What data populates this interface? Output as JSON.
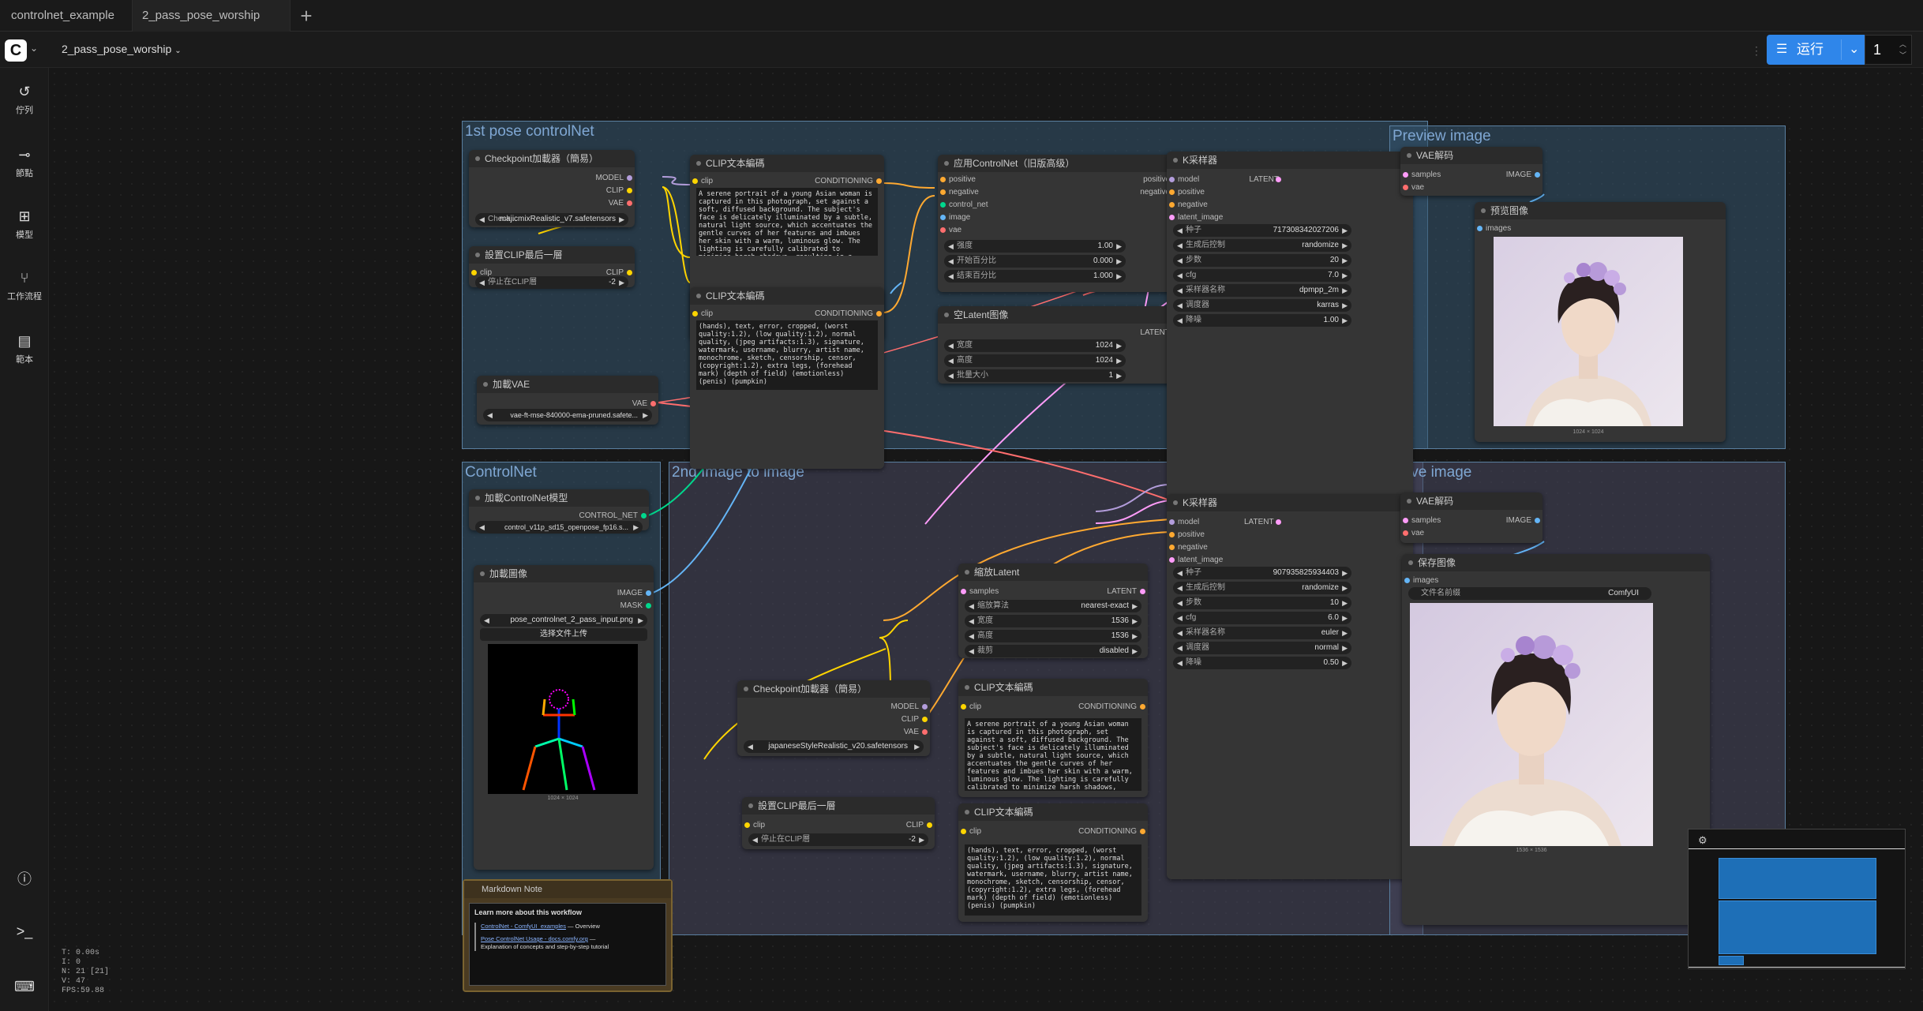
{
  "tabs": [
    {
      "label": "controlnet_example"
    },
    {
      "label": "2_pass_pose_worship"
    }
  ],
  "workflow_name": "2_pass_pose_worship",
  "run": {
    "label": "运行",
    "count": "1"
  },
  "sidebar": [
    {
      "label": "佇列",
      "icon": "history-icon"
    },
    {
      "label": "節點",
      "icon": "node-icon"
    },
    {
      "label": "模型",
      "icon": "model-icon"
    },
    {
      "label": "工作流程",
      "icon": "workflow-icon"
    },
    {
      "label": "範本",
      "icon": "template-icon"
    }
  ],
  "groups": {
    "g1": "1st pose controlNet",
    "g2": "Preview image",
    "g3": "ControlNet",
    "g4": "2nd Image to image",
    "g5": "Save image"
  },
  "nodes": {
    "ckpt1": {
      "title": "Checkpoint加載器（簡易）",
      "out_model": "MODEL",
      "out_clip": "CLIP",
      "out_vae": "VAE",
      "w_label": "Check...",
      "w_value": "majicmixRealistic_v7.safetensors"
    },
    "clipskip1": {
      "title": "設置CLIP最后一層",
      "in": "clip",
      "out": "CLIP",
      "w_label": "停止在CLIP層",
      "w_value": "-2"
    },
    "vae1": {
      "title": "加載VAE",
      "out": "VAE",
      "w_value": "vae-ft-mse-840000-ema-pruned.safete..."
    },
    "clip_pos1": {
      "title": "CLIP文本編碼",
      "in": "clip",
      "out": "CONDITIONING",
      "text": "A serene portrait of a young Asian woman is captured in this photograph, set against a soft, diffused background. The subject's face is delicately illuminated by a subtle, natural light source, which accentuates the gentle curves of her features and imbues her skin with a warm, luminous glow. The lighting is carefully calibrated to minimize harsh shadows, resulting in a softly nuanced and realistic representation of the subject's complexion."
    },
    "clip_neg1": {
      "title": "CLIP文本編碼",
      "in": "clip",
      "out": "CONDITIONING",
      "text": "(hands), text, error, cropped, (worst quality:1.2), (low quality:1.2), normal quality, (jpeg artifacts:1.3), signature, watermark, username, blurry, artist name, monochrome, sketch, censorship, censor, (copyright:1.2), extra legs, (forehead mark) (depth of field) (emotionless) (penis) (pumpkin)"
    },
    "apply_cn": {
      "title": "应用ControlNet（旧版高级）",
      "in": [
        "positive",
        "negative",
        "control_net",
        "image",
        "vae"
      ],
      "out": [
        "positive",
        "negative"
      ],
      "w": [
        {
          "l": "强度",
          "v": "1.00"
        },
        {
          "l": "开始百分比",
          "v": "0.000"
        },
        {
          "l": "结束百分比",
          "v": "1.000"
        }
      ]
    },
    "empty_latent": {
      "title": "空Latent图像",
      "out": "LATENT",
      "w": [
        {
          "l": "宽度",
          "v": "1024"
        },
        {
          "l": "高度",
          "v": "1024"
        },
        {
          "l": "批量大小",
          "v": "1"
        }
      ]
    },
    "ksampler1": {
      "title": "K采样器",
      "in": [
        "model",
        "positive",
        "negative",
        "latent_image"
      ],
      "out": "LATENT",
      "w": [
        {
          "l": "种子",
          "v": "717308342027206"
        },
        {
          "l": "生成后控制",
          "v": "randomize"
        },
        {
          "l": "步数",
          "v": "20"
        },
        {
          "l": "cfg",
          "v": "7.0"
        },
        {
          "l": "采样器名称",
          "v": "dpmpp_2m"
        },
        {
          "l": "调度器",
          "v": "karras"
        },
        {
          "l": "降噪",
          "v": "1.00"
        }
      ]
    },
    "vaedecode1": {
      "title": "VAE解码",
      "in": [
        "samples",
        "vae"
      ],
      "out": "IMAGE"
    },
    "preview": {
      "title": "预览图像",
      "in": "images",
      "caption": "1024 × 1024"
    },
    "cn_loader": {
      "title": "加載ControlNet模型",
      "out": "CONTROL_NET",
      "w_value": "control_v11p_sd15_openpose_fp16.s..."
    },
    "load_image": {
      "title": "加載圖像",
      "out_image": "IMAGE",
      "out_mask": "MASK",
      "w_value": "pose_controlnet_2_pass_input.png",
      "upload": "选择文件上传",
      "caption": "1024 × 1024"
    },
    "upscale": {
      "title": "縮放Latent",
      "in": "samples",
      "out": "LATENT",
      "w": [
        {
          "l": "缩放算法",
          "v": "nearest-exact"
        },
        {
          "l": "宽度",
          "v": "1536"
        },
        {
          "l": "高度",
          "v": "1536"
        },
        {
          "l": "裁剪",
          "v": "disabled"
        }
      ]
    },
    "ckpt2": {
      "title": "Checkpoint加載器（簡易）",
      "out_model": "MODEL",
      "out_clip": "CLIP",
      "out_vae": "VAE",
      "w_value": "japaneseStyleRealistic_v20.safetensors"
    },
    "clipskip2": {
      "title": "設置CLIP最后一層",
      "in": "clip",
      "out": "CLIP",
      "w_label": "停止在CLIP層",
      "w_value": "-2"
    },
    "clip_pos2": {
      "title": "CLIP文本編碼",
      "in": "clip",
      "out": "CONDITIONING",
      "text": "A serene portrait of a young Asian woman is captured in this photograph, set against a soft, diffused background. The subject's face is delicately illuminated by a subtle, natural light source, which accentuates the gentle curves of her features and imbues her skin with a warm, luminous glow. The lighting is carefully calibrated to minimize harsh shadows, resulting in a softly nuanced and realistic representation of the subject's"
    },
    "clip_neg2": {
      "title": "CLIP文本編碼",
      "in": "clip",
      "out": "CONDITIONING",
      "text": "(hands), text, error, cropped, (worst quality:1.2), (low quality:1.2), normal quality, (jpeg artifacts:1.3), signature, watermark, username, blurry, artist name, monochrome, sketch, censorship, censor, (copyright:1.2), extra legs, (forehead mark) (depth of field) (emotionless) (penis) (pumpkin)"
    },
    "ksampler2": {
      "title": "K采样器",
      "in": [
        "model",
        "positive",
        "negative",
        "latent_image"
      ],
      "out": "LATENT",
      "w": [
        {
          "l": "种子",
          "v": "907935825934403"
        },
        {
          "l": "生成后控制",
          "v": "randomize"
        },
        {
          "l": "步数",
          "v": "10"
        },
        {
          "l": "cfg",
          "v": "6.0"
        },
        {
          "l": "采样器名称",
          "v": "euler"
        },
        {
          "l": "调度器",
          "v": "normal"
        },
        {
          "l": "降噪",
          "v": "0.50"
        }
      ]
    },
    "vaedecode2": {
      "title": "VAE解码",
      "in": [
        "samples",
        "vae"
      ],
      "out": "IMAGE"
    },
    "save": {
      "title": "保存图像",
      "in": "images",
      "w_label": "文件名前缀",
      "w_value": "ComfyUI",
      "caption": "1536 × 1536"
    }
  },
  "note": {
    "title": "Markdown Note",
    "heading": "Learn more about this workflow",
    "link1": "ControlNet - ComfyUI_examples",
    "link1_suffix": " — Overview",
    "link2": "Pose ControlNet Usage - docs.comfy.org",
    "link2_suffix": " — ",
    "link2_desc": "Explanation of concepts and step-by-step tutorial"
  },
  "stats": {
    "t": "T: 0.00s",
    "i": "I: 0",
    "n": "N: 21 [21]",
    "v": "V: 47",
    "fps": "FPS:59.88"
  },
  "colors": {
    "accent": "#2f86ea",
    "model": "#b39ddb",
    "clip": "#ffd500",
    "vae": "#ff6e6e",
    "conditioning": "#ffa931",
    "latent": "#ff9cf9",
    "image": "#64b5f6",
    "control_net": "#00d78d"
  }
}
